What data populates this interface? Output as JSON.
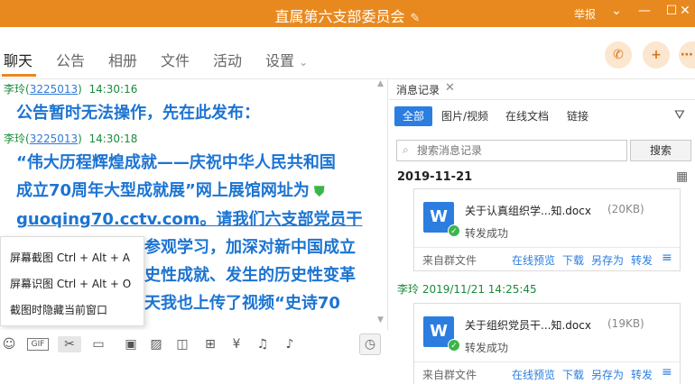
{
  "window": {
    "title": "直属第六支部委员会",
    "report_label": "举报",
    "controls": [
      "⌄",
      "—",
      "☐",
      "✕"
    ]
  },
  "nav": {
    "tabs": [
      "聊天",
      "公告",
      "相册",
      "文件",
      "活动",
      "设置"
    ],
    "settings_arrow": "⌄",
    "active_tab": "聊天",
    "accent_color": "#e8891f"
  },
  "chat": {
    "messages": [
      {
        "sender": "李玲",
        "qq": "3225013",
        "time": "14:30:16",
        "text": "公告暂时无法操作，先在此发布："
      },
      {
        "sender": "李玲",
        "qq": "3225013",
        "time": "14:30:18",
        "lines": [
          "“伟大历程辉煌成就——庆祝中华人民共和国",
          "成立70周年大型成就展”网上展馆网址为",
          "guoqing70.cctv.com。请我们六支部党员干",
          "参观学习，加深对新中国成立",
          "史性成就、发生的历史性变革",
          "天我也上传了视频“史诗70"
        ]
      }
    ]
  },
  "context_menu": {
    "items": [
      "屏幕截图 Ctrl + Alt + A",
      "屏幕识图 Ctrl + Alt + O",
      "截图时隐藏当前窗口"
    ]
  },
  "toolbar": {
    "icons": [
      "emoji-icon",
      "gif-icon",
      "scissors-icon",
      "folder-icon",
      "image-icon",
      "image-search-icon",
      "gift-icon",
      "calendar-box-icon",
      "red-packet-icon",
      "bell-icon",
      "music-icon"
    ],
    "gif_label": "GIF"
  },
  "history": {
    "tab_label": "消息记录",
    "filters": [
      "全部",
      "图片/视频",
      "在线文档",
      "链接"
    ],
    "search_placeholder": "搜索消息记录",
    "search_button": "搜索",
    "date_header": "2019-11-21",
    "files": [
      {
        "sender_line": "",
        "name": "关于认真组织学...知.docx",
        "size": "(20KB)",
        "status": "转发成功",
        "from": "来自群文件",
        "actions": [
          "在线预览",
          "下载",
          "另存为",
          "转发"
        ]
      },
      {
        "sender_line": "李玲 2019/11/21 14:25:45",
        "name": "关于组织党员干...知.docx",
        "size": "(19KB)",
        "status": "转发成功",
        "from": "来自群文件",
        "actions": [
          "在线预览",
          "下载",
          "另存为",
          "转发"
        ]
      }
    ]
  }
}
